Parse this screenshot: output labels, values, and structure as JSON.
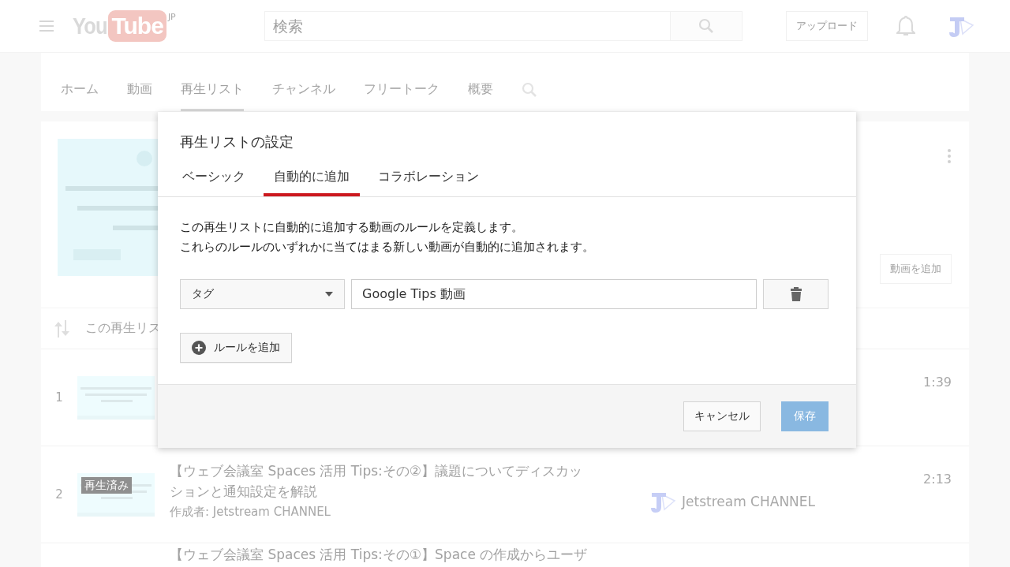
{
  "masthead": {
    "logo": {
      "you": "You",
      "tube": "Tube",
      "region": "JP"
    },
    "search": {
      "placeholder": "検索"
    },
    "upload_button": "アップロード"
  },
  "channel_tabs": [
    {
      "label": "ホーム",
      "selected": false
    },
    {
      "label": "動画",
      "selected": false
    },
    {
      "label": "再生リスト",
      "selected": true
    },
    {
      "label": "チャンネル",
      "selected": false
    },
    {
      "label": "フリートーク",
      "selected": false
    },
    {
      "label": "概要",
      "selected": false
    }
  ],
  "playlist_header": {
    "add_video_button": "動画を追加"
  },
  "sort_bar": {
    "label": "この再生リス"
  },
  "videos": [
    {
      "index": "1",
      "duration": "1:39"
    },
    {
      "index": "2",
      "title": "【ウェブ会議室 Spaces 活用 Tips:その②】議題についてディスカッションと通知設定を解説",
      "byline": "作成者: Jetstream CHANNEL",
      "channel": "Jetstream CHANNEL",
      "duration": "2:13",
      "watched_badge": "再生済み"
    },
    {
      "title": "【ウェブ会議室 Spaces 活用 Tips:その①】Space の作成からユーザ"
    }
  ],
  "dialog": {
    "title": "再生リストの設定",
    "tabs": [
      {
        "label": "ベーシック",
        "selected": false
      },
      {
        "label": "自動的に追加",
        "selected": true
      },
      {
        "label": "コラボレーション",
        "selected": false
      }
    ],
    "description": [
      "この再生リストに自動的に追加する動画のルールを定義します。",
      "これらのルールのいずれかに当てはまる新しい動画が自動的に追加されます。"
    ],
    "rules": [
      {
        "kind": "tag",
        "field": "タグ",
        "value": "Google Tips 動画"
      }
    ],
    "add_rule_button": "ルールを追加",
    "buttons": [
      {
        "kind": "cancel",
        "label": "キャンセル",
        "disabled": false
      },
      {
        "kind": "save",
        "label": "保存",
        "disabled": true
      }
    ]
  }
}
